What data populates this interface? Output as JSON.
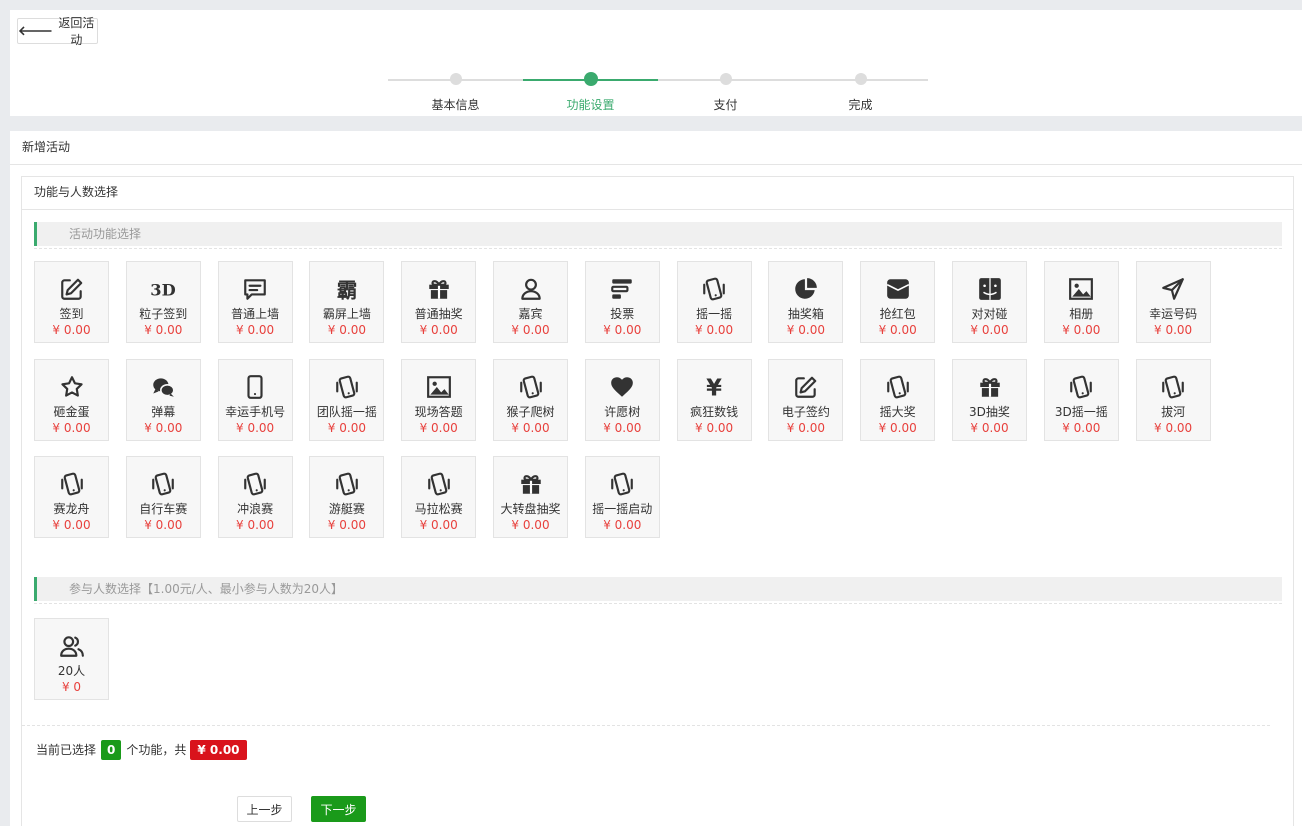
{
  "header": {
    "back_label": "返回活动",
    "steps": [
      {
        "label": "基本信息",
        "active": false
      },
      {
        "label": "功能设置",
        "active": true
      },
      {
        "label": "支付",
        "active": false
      },
      {
        "label": "完成",
        "active": false
      }
    ]
  },
  "main": {
    "title": "新增活动",
    "section_title": "功能与人数选择",
    "features_heading": "活动功能选择",
    "participants_heading": "参与人数选择【1.00元/人、最小参与人数为20人】",
    "features": [
      {
        "name": "签到",
        "price": "¥ 0.00",
        "icon": "edit-icon"
      },
      {
        "name": "粒子签到",
        "price": "¥ 0.00",
        "icon": "3d-text-icon"
      },
      {
        "name": "普通上墙",
        "price": "¥ 0.00",
        "icon": "message-icon"
      },
      {
        "name": "霸屏上墙",
        "price": "¥ 0.00",
        "icon": "ba-character-icon"
      },
      {
        "name": "普通抽奖",
        "price": "¥ 0.00",
        "icon": "gift-icon"
      },
      {
        "name": "嘉宾",
        "price": "¥ 0.00",
        "icon": "user-icon"
      },
      {
        "name": "投票",
        "price": "¥ 0.00",
        "icon": "bars-icon"
      },
      {
        "name": "摇一摇",
        "price": "¥ 0.00",
        "icon": "shake-phone-icon"
      },
      {
        "name": "抽奖箱",
        "price": "¥ 0.00",
        "icon": "pie-chart-icon"
      },
      {
        "name": "抢红包",
        "price": "¥ 0.00",
        "icon": "envelope-icon"
      },
      {
        "name": "对对碰",
        "price": "¥ 0.00",
        "icon": "finder-face-icon"
      },
      {
        "name": "相册",
        "price": "¥ 0.00",
        "icon": "image-icon"
      },
      {
        "name": "幸运号码",
        "price": "¥ 0.00",
        "icon": "send-icon"
      },
      {
        "name": "砸金蛋",
        "price": "¥ 0.00",
        "icon": "star-icon"
      },
      {
        "name": "弹幕",
        "price": "¥ 0.00",
        "icon": "comments-icon"
      },
      {
        "name": "幸运手机号",
        "price": "¥ 0.00",
        "icon": "mobile-icon"
      },
      {
        "name": "团队摇一摇",
        "price": "¥ 0.00",
        "icon": "shake-phone-icon"
      },
      {
        "name": "现场答题",
        "price": "¥ 0.00",
        "icon": "image-icon"
      },
      {
        "name": "猴子爬树",
        "price": "¥ 0.00",
        "icon": "shake-phone-icon"
      },
      {
        "name": "许愿树",
        "price": "¥ 0.00",
        "icon": "heart-icon"
      },
      {
        "name": "疯狂数钱",
        "price": "¥ 0.00",
        "icon": "yen-icon"
      },
      {
        "name": "电子签约",
        "price": "¥ 0.00",
        "icon": "edit-icon"
      },
      {
        "name": "摇大奖",
        "price": "¥ 0.00",
        "icon": "shake-phone-icon"
      },
      {
        "name": "3D抽奖",
        "price": "¥ 0.00",
        "icon": "gift-icon"
      },
      {
        "name": "3D摇一摇",
        "price": "¥ 0.00",
        "icon": "shake-phone-icon"
      },
      {
        "name": "拔河",
        "price": "¥ 0.00",
        "icon": "shake-phone-icon"
      },
      {
        "name": "赛龙舟",
        "price": "¥ 0.00",
        "icon": "shake-phone-icon"
      },
      {
        "name": "自行车赛",
        "price": "¥ 0.00",
        "icon": "shake-phone-icon"
      },
      {
        "name": "冲浪赛",
        "price": "¥ 0.00",
        "icon": "shake-phone-icon"
      },
      {
        "name": "游艇赛",
        "price": "¥ 0.00",
        "icon": "shake-phone-icon"
      },
      {
        "name": "马拉松赛",
        "price": "¥ 0.00",
        "icon": "shake-phone-icon"
      },
      {
        "name": "大转盘抽奖",
        "price": "¥ 0.00",
        "icon": "gift-icon"
      },
      {
        "name": "摇一摇启动",
        "price": "¥ 0.00",
        "icon": "shake-phone-icon"
      }
    ],
    "participants": [
      {
        "name": "20人",
        "price": "¥ 0",
        "icon": "users-icon"
      }
    ],
    "summary": {
      "prefix": "当前已选择",
      "count": "0",
      "middle": "个功能，共",
      "total": "¥ 0.00"
    },
    "buttons": {
      "prev": "上一步",
      "next": "下一步"
    }
  },
  "colors": {
    "accent_green": "#3aaa6e",
    "button_green": "#1a9a1a",
    "price_red": "#e8413d",
    "total_red": "#d9131c"
  }
}
